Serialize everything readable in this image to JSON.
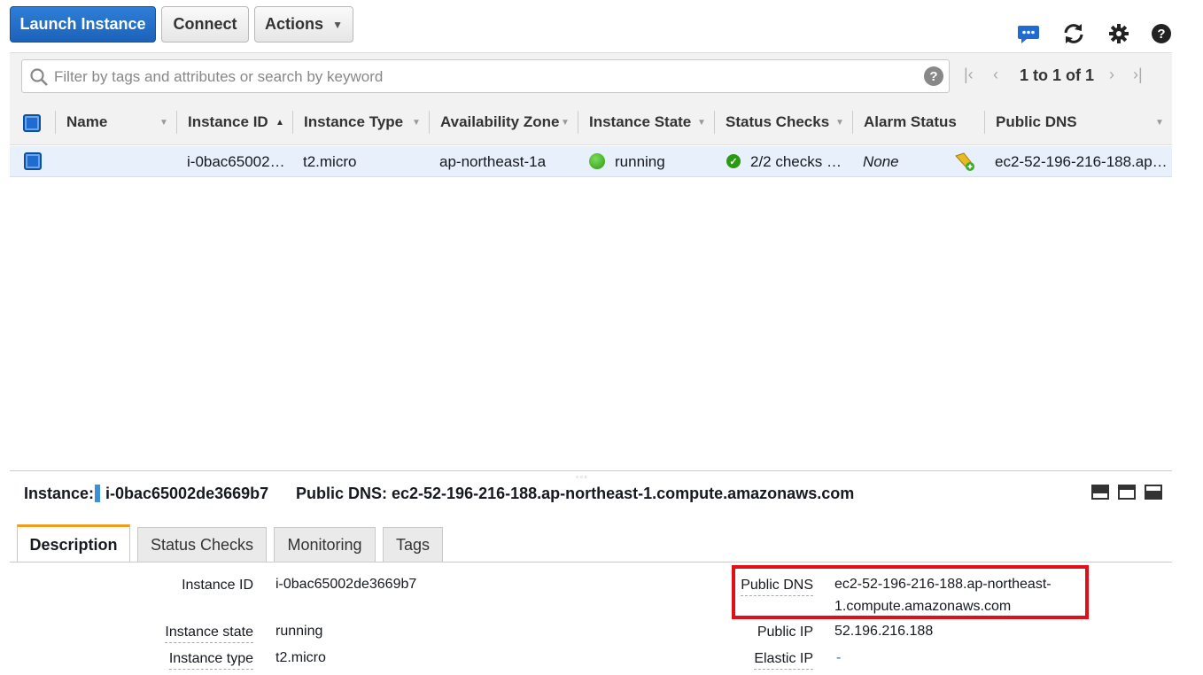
{
  "toolbar": {
    "launch_label": "Launch Instance",
    "connect_label": "Connect",
    "actions_label": "Actions",
    "icons": [
      "chat-icon",
      "refresh-icon",
      "gear-icon",
      "help-icon"
    ]
  },
  "search": {
    "placeholder": "Filter by tags and attributes or search by keyword"
  },
  "pagination": {
    "text": "1 to 1 of 1"
  },
  "table": {
    "columns": [
      "Name",
      "Instance ID",
      "Instance Type",
      "Availability Zone",
      "Instance State",
      "Status Checks",
      "Alarm Status",
      "Public DNS"
    ],
    "rows": [
      {
        "name": "",
        "instance_id": "i-0bac65002…",
        "instance_type": "t2.micro",
        "availability_zone": "ap-northeast-1a",
        "instance_state": "running",
        "status_checks": "2/2 checks …",
        "alarm_status": "None",
        "public_dns": "ec2-52-196-216-188.ap…"
      }
    ]
  },
  "details": {
    "instance_label": "Instance:",
    "instance_id": "i-0bac65002de3669b7",
    "public_dns_header": "Public DNS: ec2-52-196-216-188.ap-northeast-1.compute.amazonaws.com",
    "tabs": [
      "Description",
      "Status Checks",
      "Monitoring",
      "Tags"
    ],
    "fields_left": [
      {
        "label": "Instance ID",
        "value": "i-0bac65002de3669b7"
      },
      {
        "label": "Instance state",
        "value": "running"
      },
      {
        "label": "Instance type",
        "value": "t2.micro"
      }
    ],
    "fields_right": [
      {
        "label": "Public DNS",
        "value_line1": "ec2-52-196-216-188.ap-northeast-",
        "value_line2": "1.compute.amazonaws.com"
      },
      {
        "label": "Public IP",
        "value": "52.196.216.188"
      },
      {
        "label": "Elastic IP",
        "value": "-"
      }
    ]
  },
  "colors": {
    "primary": "#1c62b9",
    "highlight_box": "#e0101a",
    "active_tab": "#f29b1d",
    "running": "#2a9a12"
  }
}
